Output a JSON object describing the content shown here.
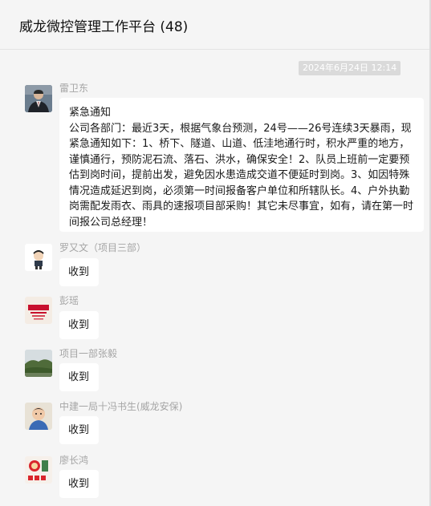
{
  "header": {
    "title": "威龙微控管理工作平台 (48)"
  },
  "chat": {
    "timestamp": "2024年6月24日 12:14",
    "messages": [
      {
        "sender": "雷卫东",
        "avatar_icon": "man-in-suit-photo-icon",
        "title": "紧急通知",
        "body": "公司各部门：最近3天，根据气象台预测，24号——26号连续3天暴雨，现紧急通知如下：1、桥下、隧道、山道、低洼地通行时，积水严重的地方，谨慎通行，预防泥石流、落石、洪水，确保安全！2、队员上班前一定要预估到岗时间，提前出发，避免因水患造成交道不便延时到岗。3、如因特殊情况造成延迟到岗，必须第一时间报备客户单位和所辖队长。4、户外执勤岗需配发雨衣、雨具的速报项目部采购！其它未尽事宜，如有，请在第一时间报公司总经理！"
      },
      {
        "sender": "罗又文（项目三部）",
        "avatar_icon": "cartoon-character-icon",
        "text": "收到"
      },
      {
        "sender": "彭瑶",
        "avatar_icon": "china-youth-red-logo-icon",
        "text": "收到"
      },
      {
        "sender": "项目一部张毅",
        "avatar_icon": "landscape-photo-icon",
        "text": "收到"
      },
      {
        "sender": "中建一局十冯书生(威龙安保)",
        "avatar_icon": "child-photo-icon",
        "text": "收到"
      },
      {
        "sender": "廖长鸿",
        "avatar_icon": "red-badge-sticker-icon",
        "text": "收到"
      }
    ]
  }
}
